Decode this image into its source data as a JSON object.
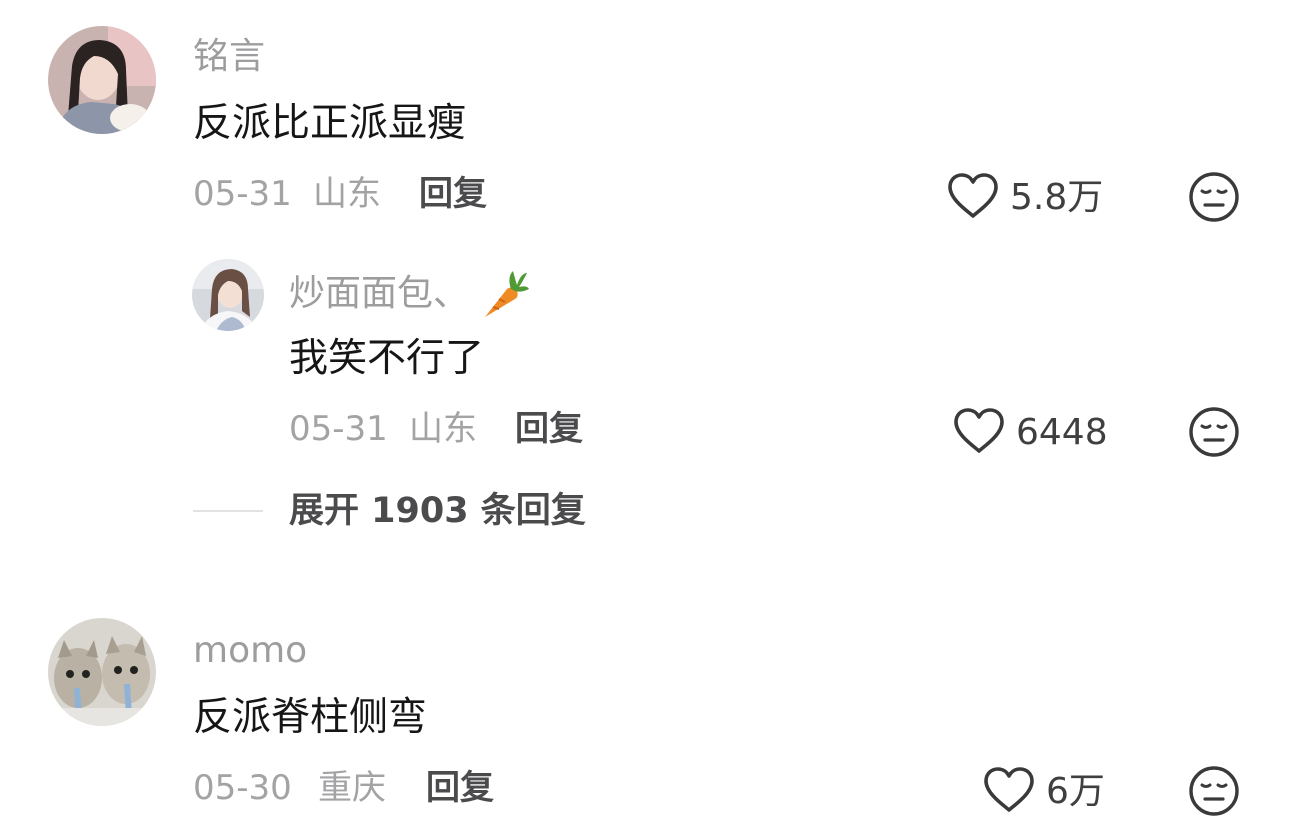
{
  "comments": [
    {
      "username": "铭言",
      "text": "反派比正派显瘦",
      "date": "05-31",
      "location": "山东",
      "reply_label": "回复",
      "likes": "5.8万",
      "replies": [
        {
          "username": "炒面面包、",
          "username_emoji": "🥕",
          "text": "我笑不行了",
          "date": "05-31",
          "location": "山东",
          "reply_label": "回复",
          "likes": "6448"
        }
      ],
      "expand_label": "展开 1903 条回复"
    },
    {
      "username": "momo",
      "text": "反派脊柱侧弯",
      "date": "05-30",
      "location": "重庆",
      "reply_label": "回复",
      "likes": "6万"
    }
  ],
  "icons": {
    "like": "heart-outline-icon",
    "dislike": "neutral-face-icon",
    "emoji": "carrot-emoji"
  },
  "colors": {
    "username": "#9d9d9f",
    "text": "#161616",
    "meta": "#a3a3a5",
    "action": "#4b4b4d"
  }
}
